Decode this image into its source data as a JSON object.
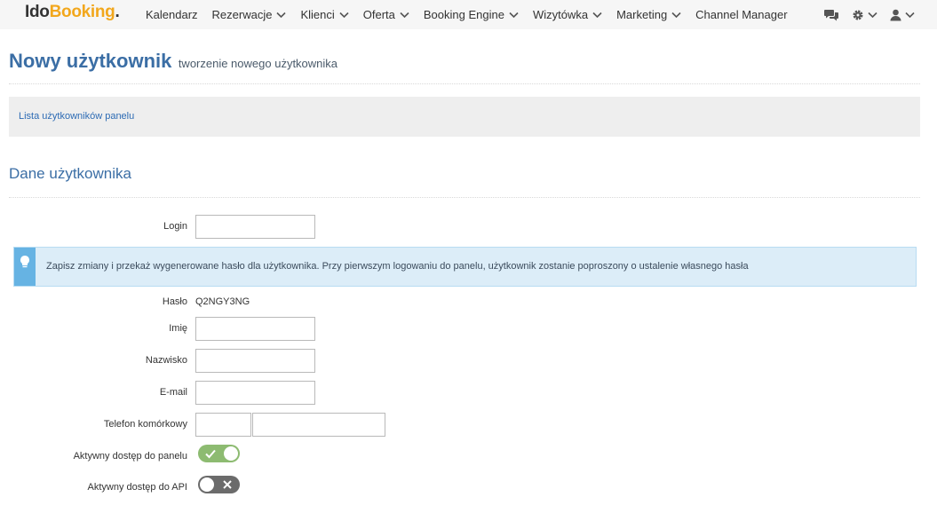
{
  "logo": {
    "part1": "Ido",
    "part2": "Booking",
    "part3": "."
  },
  "nav": {
    "items": [
      {
        "label": "Kalendarz",
        "dropdown": false
      },
      {
        "label": "Rezerwacje",
        "dropdown": true
      },
      {
        "label": "Klienci",
        "dropdown": true
      },
      {
        "label": "Oferta",
        "dropdown": true
      },
      {
        "label": "Booking Engine",
        "dropdown": true
      },
      {
        "label": "Wizytówka",
        "dropdown": true
      },
      {
        "label": "Marketing",
        "dropdown": true
      },
      {
        "label": "Channel Manager",
        "dropdown": false
      }
    ],
    "right_icons": [
      "chat-icon",
      "gear-icon",
      "user-icon"
    ]
  },
  "page": {
    "title": "Nowy użytkownik",
    "subtitle": "tworzenie nowego użytkownika"
  },
  "breadcrumb": {
    "link": "Lista użytkowników panelu"
  },
  "section": {
    "title": "Dane użytkownika"
  },
  "form": {
    "login_label": "Login",
    "login_value": "",
    "alert_text": "Zapisz zmiany i przekaż wygenerowane hasło dla użytkownika. Przy pierwszym logowaniu do panelu, użytkownik zostanie poproszony o ustalenie własnego hasła",
    "password_label": "Hasło",
    "password_value": "Q2NGY3NG",
    "first_name_label": "Imię",
    "first_name_value": "",
    "last_name_label": "Nazwisko",
    "last_name_value": "",
    "email_label": "E-mail",
    "email_value": "",
    "phone_label": "Telefon komórkowy",
    "phone_prefix_value": "",
    "phone_number_value": "",
    "panel_access_label": "Aktywny dostęp do panelu",
    "panel_access_on": true,
    "api_access_label": "Aktywny dostęp do API",
    "api_access_on": false
  },
  "colors": {
    "accent": "#3b6ea5",
    "logo_accent": "#f2a71c",
    "toggle_on": "#8dbb71",
    "toggle_off": "#6b6b6b",
    "alert_bg": "#dcedf8"
  }
}
